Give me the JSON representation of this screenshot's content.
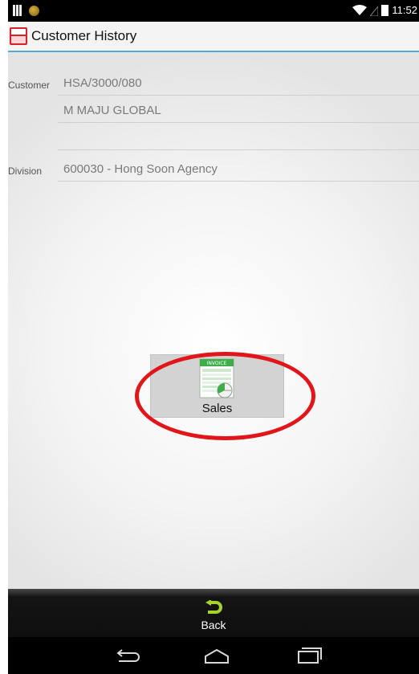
{
  "status_bar": {
    "time": "11:52"
  },
  "header": {
    "title": "Customer History",
    "app_icon": "app-logo-icon"
  },
  "form": {
    "customer_label": "Customer",
    "customer_code": "HSA/3000/080",
    "customer_name": "M MAJU GLOBAL",
    "customer_extra": "",
    "division_label": "Division",
    "division_value": "600030 - Hong Soon Agency"
  },
  "main": {
    "sales_label": "Sales",
    "sales_icon": "invoice-icon",
    "invoice_text": "INVOICE"
  },
  "bottom": {
    "back_label": "Back",
    "back_icon": "back-arrow-icon"
  },
  "nav": {
    "back": "nav-back-icon",
    "home": "nav-home-icon",
    "recents": "nav-recents-icon"
  },
  "colors": {
    "accent": "#5aa7d6",
    "highlight": "#e0161a",
    "back_arrow": "#a6d42a"
  }
}
